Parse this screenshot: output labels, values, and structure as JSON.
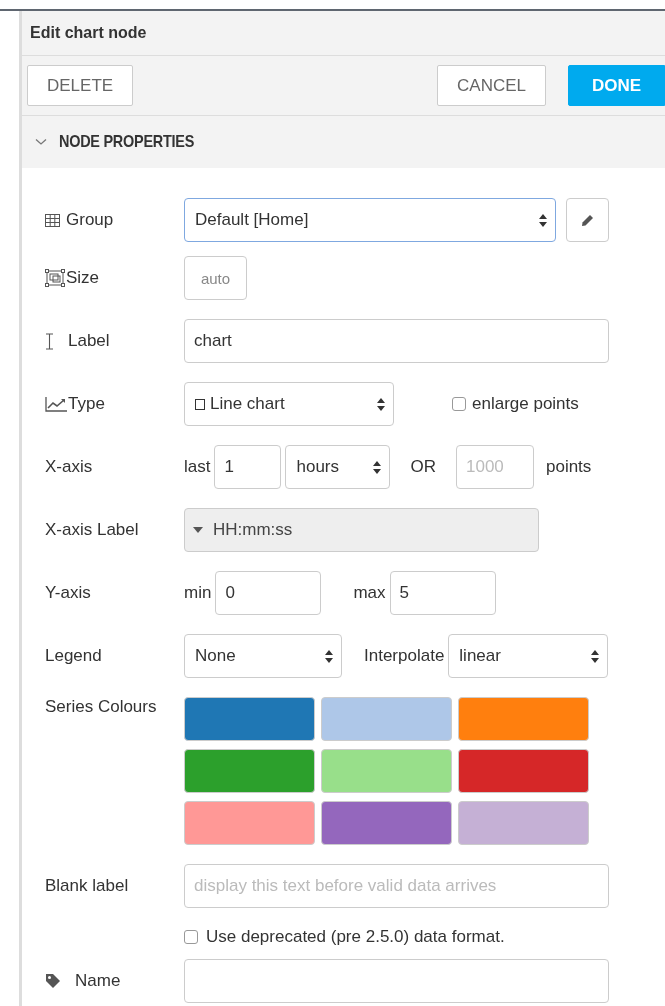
{
  "header": {
    "title": "Edit chart node"
  },
  "toolbar": {
    "delete": "DELETE",
    "cancel": "CANCEL",
    "done": "DONE"
  },
  "section": {
    "title": "NODE PROPERTIES",
    "expanded": true
  },
  "group": {
    "label": "Group",
    "value": "Default [Home]"
  },
  "size": {
    "label": "Size",
    "value": "auto"
  },
  "label_field": {
    "label": "Label",
    "value": "chart"
  },
  "type": {
    "label": "Type",
    "value": "Line chart",
    "enlarge_points": {
      "label": "enlarge points",
      "checked": false
    }
  },
  "x_axis": {
    "label": "X-axis",
    "last_label": "last",
    "last_value": "1",
    "unit": "hours",
    "or": "OR",
    "points_placeholder": "1000",
    "points_label": "points"
  },
  "x_axis_label": {
    "label": "X-axis Label",
    "value": "HH:mm:ss"
  },
  "y_axis": {
    "label": "Y-axis",
    "min_label": "min",
    "min": "0",
    "max_label": "max",
    "max": "5"
  },
  "legend": {
    "label": "Legend",
    "value": "None",
    "interpolate_label": "Interpolate",
    "interpolate": "linear"
  },
  "series_colours": {
    "label": "Series Colours",
    "colors": [
      {
        "color": "#1f77b4"
      },
      {
        "color": "#aec7e8"
      },
      {
        "color": "#ff7f0e"
      },
      {
        "color": "#2ca02c"
      },
      {
        "color": "#98df8a"
      },
      {
        "color": "#d62728"
      },
      {
        "color": "#ff9896"
      },
      {
        "color": "#9467bd"
      },
      {
        "color": "#c5b0d5"
      }
    ]
  },
  "blank_label": {
    "label": "Blank label",
    "placeholder": "display this text before valid data arrives"
  },
  "deprecated": {
    "label": "Use deprecated (pre 2.5.0) data format.",
    "checked": false
  },
  "name": {
    "label": "Name"
  }
}
